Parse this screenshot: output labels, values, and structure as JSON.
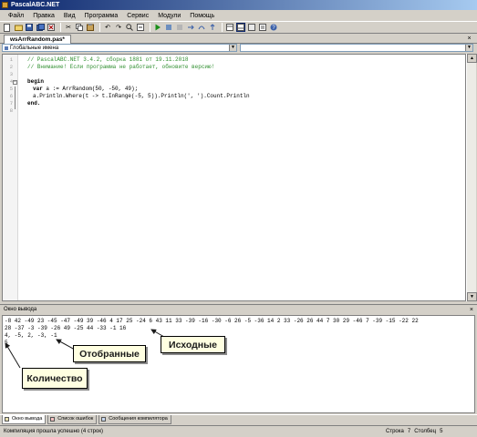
{
  "window": {
    "title": "PascalABC.NET"
  },
  "menu": [
    "Файл",
    "Правка",
    "Вид",
    "Программа",
    "Сервис",
    "Модули",
    "Помощь"
  ],
  "toolbar": {
    "icons": [
      "new-file-icon",
      "open-icon",
      "save-icon",
      "save-all-icon",
      "close-icon",
      "cut-icon",
      "copy-icon",
      "paste-icon",
      "undo-icon",
      "redo-icon",
      "find-icon",
      "replace-icon",
      "run-icon",
      "debug-icon",
      "stop-icon",
      "step-icon",
      "step-over-icon",
      "step-out-icon",
      "layout-icon",
      "layout-active-icon",
      "output-icon",
      "settings-icon",
      "help-icon"
    ]
  },
  "editor_tab": {
    "label": "wsArrRandom.pas*"
  },
  "nav": {
    "left_combo": "Глобальные имена",
    "right_combo": ""
  },
  "code": {
    "line_numbers": [
      "1",
      "2",
      "3",
      "4",
      "5",
      "6",
      "7",
      "8"
    ],
    "comment1": "// PascalABC.NET 3.4.2, сборка 1881 от 19.11.2018",
    "comment2": "// Внимание! Если программа не работает, обновите версию!",
    "begin_kw": "begin",
    "line5_kw": "var",
    "line5_rest": " a := ArrRandom(50, -50, 49);",
    "line6": "a.Println.Where(t -> t.InRange(-5, 5)).Println(', ').Count.Println",
    "end_kw": "end."
  },
  "output_panel": {
    "title": "Окно вывода",
    "lines": [
      "-8 42 -49 23 -45 -47 -49 39 -46 4 17 25 -24 6 43 11 33 -39 -16 -30 -6 26 -5 -36 14 2 33 -26 26 44 7 30 29 -46 7 -39 -15 -22 22",
      "28 -37 -3 -39 -26 49 -25 44 -33 -1 16",
      "4, -5, 2, -3, -1",
      "5"
    ]
  },
  "callouts": {
    "source": "Исходные",
    "selected": "Отобранные",
    "count": "Количество"
  },
  "bottom_tabs": [
    "Окно вывода",
    "Список ошибок",
    "Сообщения компилятора"
  ],
  "status": {
    "message": "Компиляция прошла успешно (4 строк)",
    "row_label": "Строка",
    "row": "7",
    "col_label": "Столбец",
    "col": "5"
  }
}
